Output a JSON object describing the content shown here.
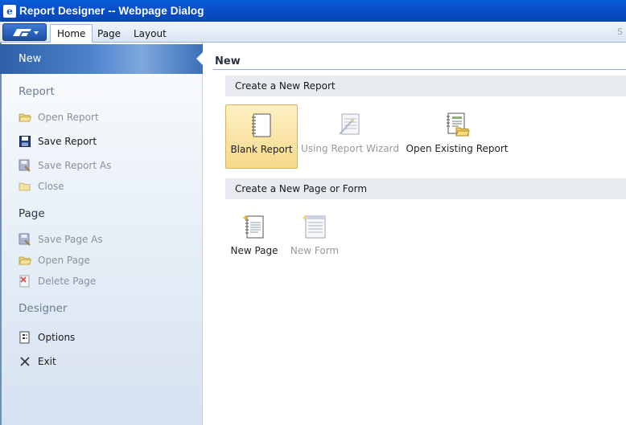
{
  "window": {
    "title": "Report Designer -- Webpage Dialog",
    "app_icon": "ie-page-icon"
  },
  "ribbon": {
    "tabs": [
      {
        "label": "Home",
        "active": true
      },
      {
        "label": "Page"
      },
      {
        "label": "Layout"
      }
    ],
    "right_text": "S"
  },
  "sidebar": {
    "selected": "New",
    "sections": [
      {
        "header": "Report",
        "items": [
          {
            "label": "Open Report",
            "icon": "folder-open-icon",
            "enabled": false
          },
          {
            "label": "Save Report",
            "icon": "floppy-disk-icon",
            "enabled": true
          },
          {
            "label": "Save Report As",
            "icon": "save-as-icon",
            "enabled": false
          },
          {
            "label": "Close",
            "icon": "folder-close-icon",
            "enabled": false
          }
        ]
      },
      {
        "header": "Page",
        "items": [
          {
            "label": "Save Page As",
            "icon": "save-as-icon",
            "enabled": false
          },
          {
            "label": "Open Page",
            "icon": "folder-open-icon",
            "enabled": false
          },
          {
            "label": "Delete Page",
            "icon": "delete-page-icon",
            "enabled": false
          }
        ]
      },
      {
        "header": "Designer",
        "items": [
          {
            "label": "Options",
            "icon": "options-icon",
            "enabled": true
          },
          {
            "label": "Exit",
            "icon": "close-x-icon",
            "enabled": true
          }
        ]
      }
    ]
  },
  "main": {
    "title": "New",
    "groups": [
      {
        "header": "Create a New Report",
        "tiles": [
          {
            "label": "Blank Report",
            "icon": "blank-report-icon",
            "selected": true,
            "enabled": true
          },
          {
            "label": "Using Report Wizard",
            "icon": "report-wizard-icon",
            "enabled": false
          },
          {
            "label": "Open Existing Report",
            "icon": "open-report-icon",
            "enabled": true
          }
        ]
      },
      {
        "header": "Create a New Page or Form",
        "tiles": [
          {
            "label": "New Page",
            "icon": "new-page-icon",
            "enabled": true
          },
          {
            "label": "New Form",
            "icon": "new-form-icon",
            "enabled": false
          }
        ]
      }
    ]
  },
  "colors": {
    "titlebar": "#0a4fc8",
    "selected_nav": "#4c84cc",
    "selected_tile": "#f7d98a"
  }
}
